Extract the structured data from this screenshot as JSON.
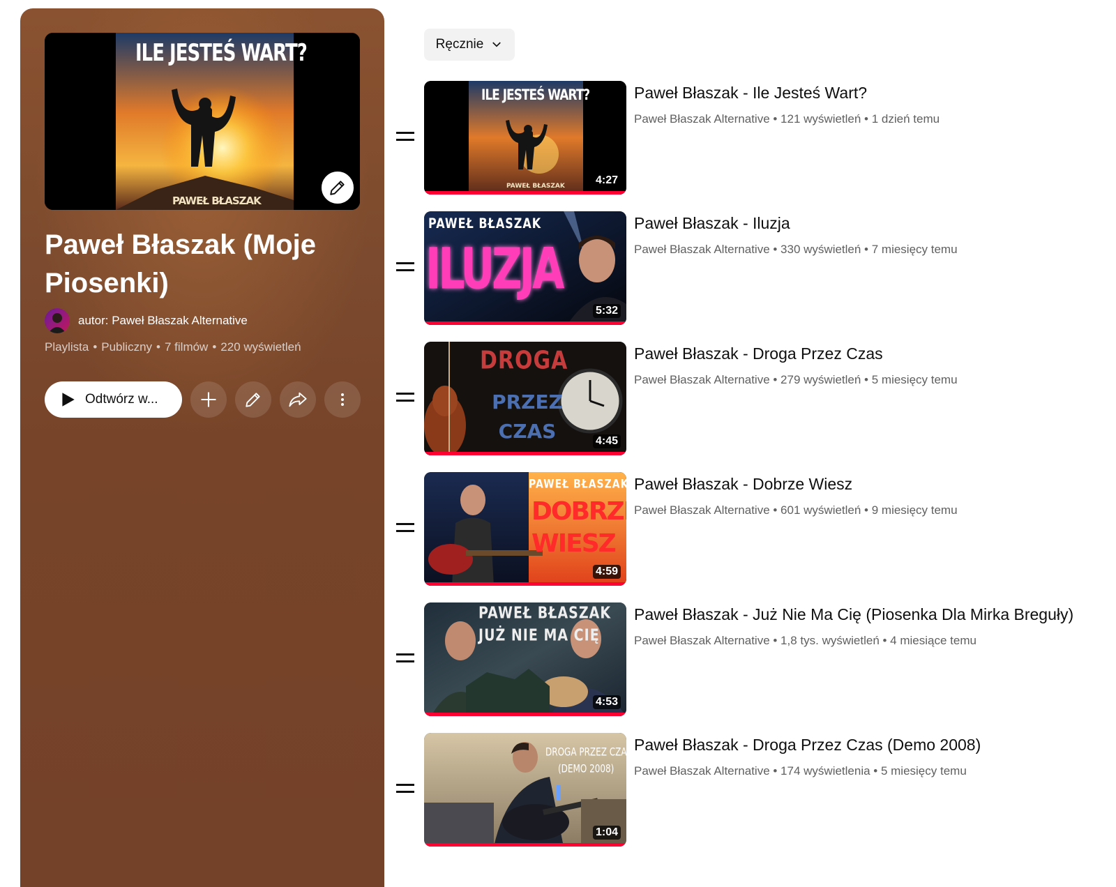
{
  "playlist": {
    "title": "Paweł Błaszak (Moje Piosenki)",
    "cover_text_top": "ILE JESTEŚ WART?",
    "cover_text_bottom": "PAWEŁ BŁASZAK",
    "author": "autor: Paweł Błaszak Alternative",
    "meta": {
      "type": "Playlista",
      "privacy": "Publiczny",
      "videos": "7 filmów",
      "views": "220 wyświetleń",
      "separator": "•"
    },
    "play_label": "Odtwórz w...",
    "colors": {
      "panel": "#7c4a2e",
      "progress": "#ff0033"
    }
  },
  "sort": {
    "label": "Ręcznie"
  },
  "videos": [
    {
      "title": "Paweł Błaszak - Ile Jesteś Wart?",
      "meta": "Paweł Błaszak Alternative • 121 wyświetleń • 1 dzień temu",
      "duration": "4:27",
      "thumb_top": "ILE JESTEŚ WART?",
      "thumb_bottom": "PAWEŁ BŁASZAK"
    },
    {
      "title": "Paweł Błaszak - Iluzja",
      "meta": "Paweł Błaszak Alternative • 330 wyświetleń • 7 miesięcy temu",
      "duration": "5:32",
      "thumb_top": "PAWEŁ BŁASZAK",
      "thumb_bottom": "ILUZJA"
    },
    {
      "title": "Paweł Błaszak - Droga Przez Czas",
      "meta": "Paweł Błaszak Alternative • 279 wyświetleń • 5 miesięcy temu",
      "duration": "4:45",
      "thumb_top": "DROGA",
      "thumb_bottom": "PRZEZ CZAS"
    },
    {
      "title": "Paweł Błaszak - Dobrze Wiesz",
      "meta": "Paweł Błaszak Alternative • 601 wyświetleń • 9 miesięcy temu",
      "duration": "4:59",
      "thumb_top": "PAWEŁ BŁASZAK",
      "thumb_bottom": "DOBRZE WIESZ"
    },
    {
      "title": "Paweł Błaszak - Już Nie Ma Cię (Piosenka Dla Mirka Breguły)",
      "meta": "Paweł Błaszak Alternative • 1,8 tys. wyświetleń • 4 miesiące temu",
      "duration": "4:53",
      "thumb_top": "PAWEŁ BŁASZAK",
      "thumb_bottom": "JUŻ NIE MA CIĘ"
    },
    {
      "title": "Paweł Błaszak - Droga Przez Czas (Demo 2008)",
      "meta": "Paweł Błaszak Alternative • 174 wyświetlenia • 5 miesięcy temu",
      "duration": "1:04",
      "thumb_top": "DROGA PRZEZ CZAS",
      "thumb_bottom": "(DEMO 2008)"
    }
  ]
}
